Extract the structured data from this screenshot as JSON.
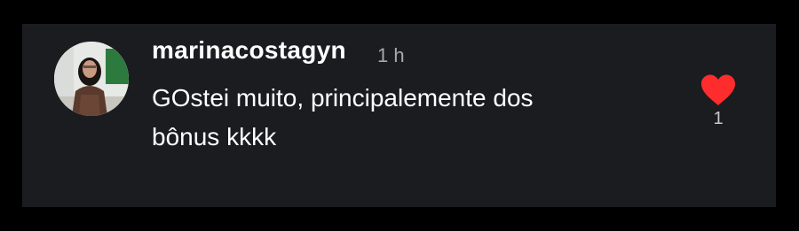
{
  "comment": {
    "username": "marinacostagyn",
    "timestamp": "1 h",
    "text_line1": "GOstei muito, principalemente dos",
    "text_line2": "bônus kkkk",
    "avatar": "profile-photo"
  },
  "like": {
    "icon": "heart-icon",
    "color": "#fe2c2c",
    "count": "1"
  },
  "colors": {
    "background": "#000000",
    "card": "#1b1c20",
    "text": "#ffffff",
    "muted_text": "#a8a8ad"
  }
}
